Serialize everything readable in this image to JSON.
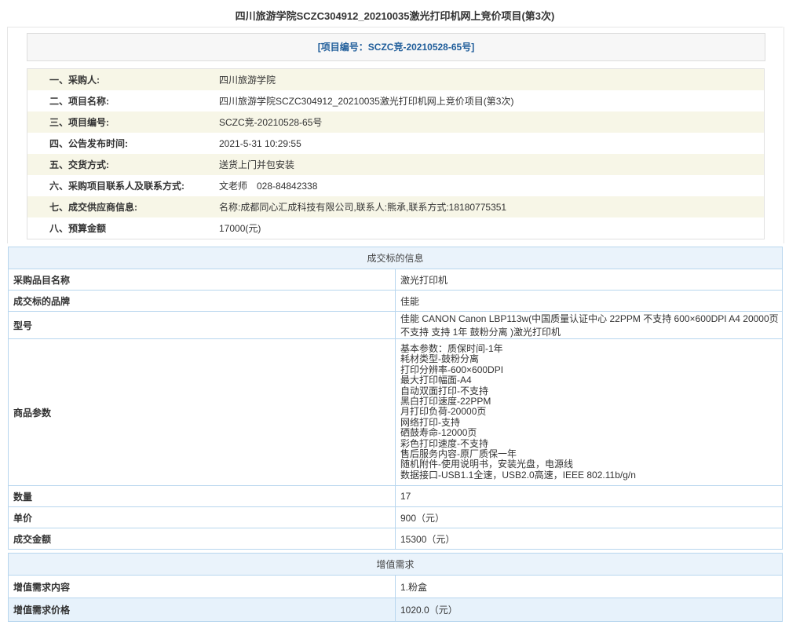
{
  "page": {
    "title": "四川旅游学院SCZC304912_20210035激光打印机网上竞价项目(第3次)",
    "project_number_banner": "[项目编号：SCZC竞-20210528-65号]"
  },
  "info": [
    {
      "label": "一、采购人:",
      "value": "四川旅游学院"
    },
    {
      "label": "二、项目名称:",
      "value": "四川旅游学院SCZC304912_20210035激光打印机网上竞价项目(第3次)"
    },
    {
      "label": "三、项目编号:",
      "value": "SCZC竞-20210528-65号"
    },
    {
      "label": "四、公告发布时间:",
      "value": "2021-5-31 10:29:55"
    },
    {
      "label": "五、交货方式:",
      "value": "送货上门并包安装"
    },
    {
      "label": "六、采购项目联系人及联系方式:",
      "value": "文老师　028-84842338"
    },
    {
      "label": "七、成交供应商信息:",
      "value": "名称:成都同心汇成科技有限公司,联系人:熊承,联系方式:18180775351"
    },
    {
      "label": "八、预算金额",
      "value": "17000(元)"
    }
  ],
  "deal": {
    "header": "成交标的信息",
    "item_name_label": "采购品目名称",
    "item_name": "激光打印机",
    "brand_label": "成交标的品牌",
    "brand": "佳能",
    "model_label": "型号",
    "model": "佳能 CANON Canon LBP113w(中国质量认证中心 22PPM 不支持 600×600DPI A4 20000页 不支持 支持 1年 鼓粉分离 )激光打印机",
    "params_label": "商品参数",
    "params": [
      "基本参数：质保时间-1年",
      "耗材类型-鼓粉分离",
      "打印分辨率-600×600DPI",
      "最大打印幅面-A4",
      "自动双面打印-不支持",
      "黑白打印速度-22PPM",
      "月打印负荷-20000页",
      "网络打印-支持",
      "硒鼓寿命-12000页",
      "彩色打印速度-不支持",
      "售后服务内容-原厂质保一年",
      "随机附件-使用说明书，安装光盘，电源线",
      "数据接口-USB1.1全速，USB2.0高速，IEEE 802.11b/g/n"
    ],
    "quantity_label": "数量",
    "quantity": "17",
    "unit_price_label": "单价",
    "unit_price": "900（元）",
    "total_label": "成交金额",
    "total": "15300（元）"
  },
  "value_added": {
    "header": "增值需求",
    "content_label": "增值需求内容",
    "content": "1.粉盒",
    "price_label": "增值需求价格",
    "price": "1020.0（元）"
  }
}
